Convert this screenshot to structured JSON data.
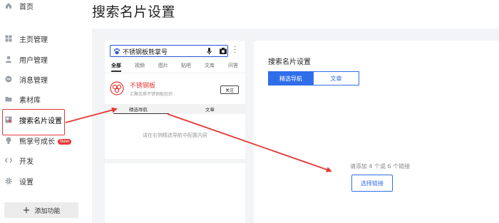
{
  "sidebar": {
    "items": [
      {
        "label": "首页",
        "icon": "home-icon"
      },
      {
        "label": "主页管理",
        "icon": "grid-icon"
      },
      {
        "label": "用户管理",
        "icon": "user-icon"
      },
      {
        "label": "消息管理",
        "icon": "message-icon"
      },
      {
        "label": "素材库",
        "icon": "folder-icon"
      },
      {
        "label": "搜索名片设置",
        "icon": "card-icon"
      },
      {
        "label": "熊掌号成长",
        "icon": "paw-icon",
        "badge": "New"
      },
      {
        "label": "开发",
        "icon": "code-icon"
      },
      {
        "label": "设置",
        "icon": "gear-icon"
      }
    ],
    "add_button": {
      "icon": "plus-icon",
      "label": "添加功能"
    }
  },
  "page": {
    "title": "搜索名片设置"
  },
  "preview": {
    "search_query": "不锈钢板熊掌号",
    "tabs": [
      "全部",
      "视频",
      "图片",
      "贴吧",
      "文库",
      "问答"
    ],
    "card": {
      "name": "不锈钢板",
      "desc": "汇聚优质不锈钢板知识",
      "follow_label": "关注"
    },
    "profile_tabs": [
      "精选导航",
      "文章"
    ],
    "empty_text": "请在右侧精选导航中配置内容"
  },
  "settings": {
    "title": "搜索名片设置",
    "segments": [
      "精选导航",
      "文章"
    ],
    "active_segment": "精选导航",
    "hint": "请添加 4 个或 6 个链接",
    "choose_button": "选择链接"
  },
  "colors": {
    "accent": "#2f6ee8",
    "annotation": "#e53935",
    "brand_red": "#e53935"
  }
}
